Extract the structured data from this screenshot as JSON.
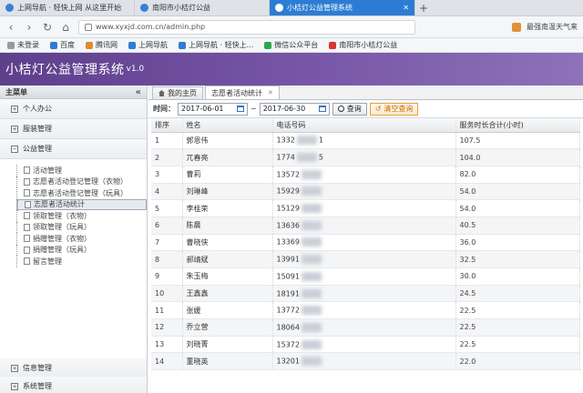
{
  "browser": {
    "tabs": [
      {
        "label": "上网导航 · 轻快上网 从这里开始"
      },
      {
        "label": "南阳市小桔灯公益"
      },
      {
        "label": "小桔灯公益管理系统"
      }
    ],
    "url": "www.xyxjd.com.cn/admin.php",
    "weather": "最强南温天气来",
    "bookmarks": [
      {
        "label": "未登录"
      },
      {
        "label": "百度"
      },
      {
        "label": "腾讯网"
      },
      {
        "label": "上网导航"
      },
      {
        "label": "上网导航 · 轻快上..."
      },
      {
        "label": "微信公众平台"
      },
      {
        "label": "南阳市小桔灯公益"
      }
    ]
  },
  "app": {
    "title": "小桔灯公益管理系统",
    "version": "v1.0"
  },
  "sidebar": {
    "header": "主菜单",
    "groups": [
      {
        "label": "个人办公"
      },
      {
        "label": "服装管理"
      },
      {
        "label": "公益管理"
      }
    ],
    "items": [
      {
        "label": "活动管理"
      },
      {
        "label": "志愿者活动登记管理（衣物）"
      },
      {
        "label": "志愿者活动登记管理（玩具）"
      },
      {
        "label": "志愿者活动统计"
      },
      {
        "label": "领取管理（衣物）"
      },
      {
        "label": "领取管理（玩具）"
      },
      {
        "label": "捐赠管理（衣物）"
      },
      {
        "label": "捐赠管理（玩具）"
      },
      {
        "label": "留言管理"
      }
    ],
    "bottom": [
      {
        "label": "信息管理"
      },
      {
        "label": "系统管理"
      }
    ]
  },
  "page_tabs": [
    {
      "label": "我的主页"
    },
    {
      "label": "志愿者活动统计"
    }
  ],
  "filter": {
    "label": "时间：",
    "start": "2017-06-01",
    "separator": "~",
    "end": "2017-06-30",
    "query": "查询",
    "clear": "清空查询"
  },
  "table": {
    "headers": [
      "排序",
      "姓名",
      "电话号码",
      "服务时长合计(小时)"
    ],
    "rows": [
      {
        "rank": "1",
        "name": "郭恩伟",
        "phone_a": "1332",
        "phone_b": "1",
        "hours": "107.5"
      },
      {
        "rank": "2",
        "name": "兀春亮",
        "phone_a": "1774",
        "phone_b": "5",
        "hours": "104.0"
      },
      {
        "rank": "3",
        "name": "曹莉",
        "phone_a": "13572",
        "phone_b": "",
        "hours": "82.0"
      },
      {
        "rank": "4",
        "name": "刘琳峰",
        "phone_a": "15929",
        "phone_b": "",
        "hours": "54.0"
      },
      {
        "rank": "5",
        "name": "李桂荣",
        "phone_a": "15129",
        "phone_b": "",
        "hours": "54.0"
      },
      {
        "rank": "6",
        "name": "陈晨",
        "phone_a": "13636",
        "phone_b": "",
        "hours": "40.5"
      },
      {
        "rank": "7",
        "name": "曹晓侠",
        "phone_a": "13369",
        "phone_b": "",
        "hours": "36.0"
      },
      {
        "rank": "8",
        "name": "郝靖斌",
        "phone_a": "13991",
        "phone_b": "",
        "hours": "32.5"
      },
      {
        "rank": "9",
        "name": "朱玉梅",
        "phone_a": "15091",
        "phone_b": "",
        "hours": "30.0"
      },
      {
        "rank": "10",
        "name": "王鑫鑫",
        "phone_a": "18191",
        "phone_b": "",
        "hours": "24.5"
      },
      {
        "rank": "11",
        "name": "张媛",
        "phone_a": "13772",
        "phone_b": "",
        "hours": "22.5"
      },
      {
        "rank": "12",
        "name": "乔立营",
        "phone_a": "18064",
        "phone_b": "",
        "hours": "22.5"
      },
      {
        "rank": "13",
        "name": "刘晓菁",
        "phone_a": "15372",
        "phone_b": "",
        "hours": "22.5"
      },
      {
        "rank": "14",
        "name": "董晓英",
        "phone_a": "13201",
        "phone_b": "",
        "hours": "22.0"
      }
    ]
  },
  "colors": {
    "header_gradient_start": "#5e3f8c",
    "header_gradient_end": "#8e72b8",
    "active_tab": "#2d7cd3",
    "clear_button": "#e3a23c"
  }
}
